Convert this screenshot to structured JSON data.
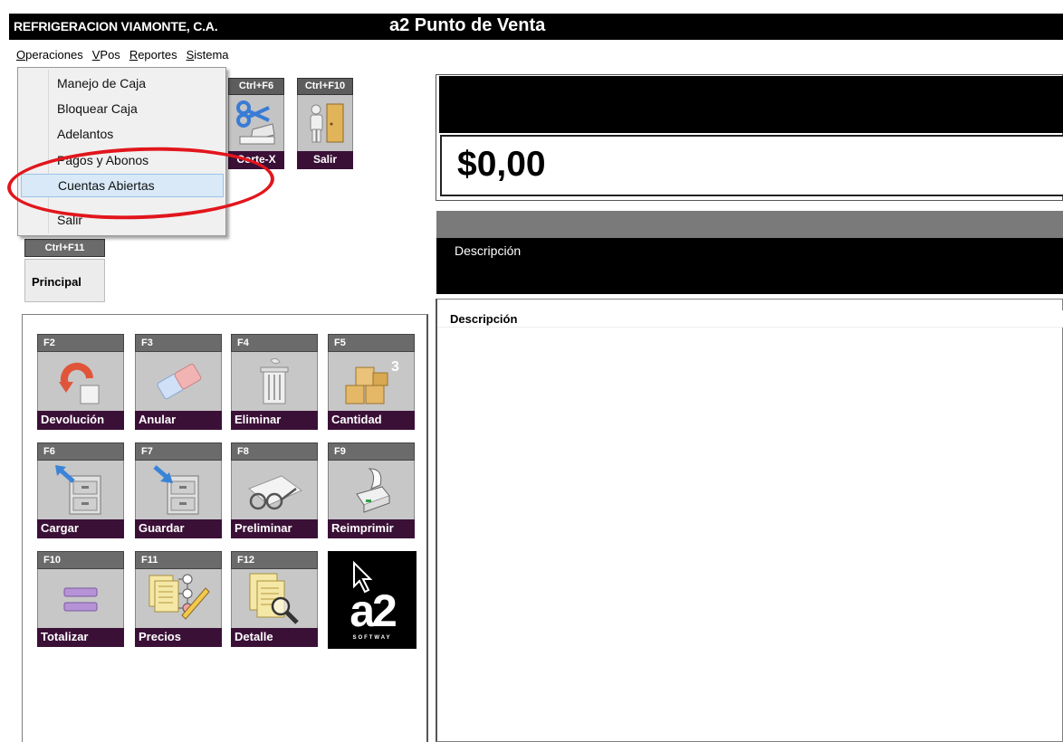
{
  "window": {
    "company": "REFRIGERACION VIAMONTE, C.A.",
    "title": "a2 Punto de Venta"
  },
  "menubar": [
    "Operaciones",
    "VPos",
    "Reportes",
    "Sistema"
  ],
  "dropdown": {
    "items": [
      "Manejo de Caja",
      "Bloquear Caja",
      "Adelantos",
      "Pagos y Abonos",
      "Cuentas Abiertas",
      "Salir"
    ],
    "highlighted": "Cuentas Abiertas"
  },
  "top_buttons": [
    {
      "key": "Ctrl+F6",
      "label": "Corte-X",
      "icon": "scissors-icon"
    },
    {
      "key": "Ctrl+F10",
      "label": "Salir",
      "icon": "exit-door-icon"
    }
  ],
  "principal": {
    "key": "Ctrl+F11",
    "label": "Principal"
  },
  "function_buttons": [
    {
      "key": "F2",
      "label": "Devolución",
      "icon": "return-icon"
    },
    {
      "key": "F3",
      "label": "Anular",
      "icon": "eraser-icon"
    },
    {
      "key": "F4",
      "label": "Eliminar",
      "icon": "trash-icon"
    },
    {
      "key": "F5",
      "label": "Cantidad",
      "icon": "boxes-icon"
    },
    {
      "key": "F6",
      "label": "Cargar",
      "icon": "cabinet-load-icon"
    },
    {
      "key": "F7",
      "label": "Guardar",
      "icon": "cabinet-save-icon"
    },
    {
      "key": "F8",
      "label": "Preliminar",
      "icon": "glasses-icon"
    },
    {
      "key": "F9",
      "label": "Reimprimir",
      "icon": "printer-icon"
    },
    {
      "key": "F10",
      "label": "Totalizar",
      "icon": "equals-icon"
    },
    {
      "key": "F11",
      "label": "Precios",
      "icon": "price-list-icon"
    },
    {
      "key": "F12",
      "label": "Detalle",
      "icon": "magnifier-document-icon"
    }
  ],
  "logo": {
    "mark": "a2",
    "brand": "SOFTWAY"
  },
  "total": {
    "amount": "$0,00"
  },
  "item_description_label": "Descripción",
  "list": {
    "header": "Descripción"
  },
  "colors": {
    "label_bg": "#3b1037",
    "highlight": "#d9e9f8",
    "annotation_oval": "#e1161c"
  }
}
